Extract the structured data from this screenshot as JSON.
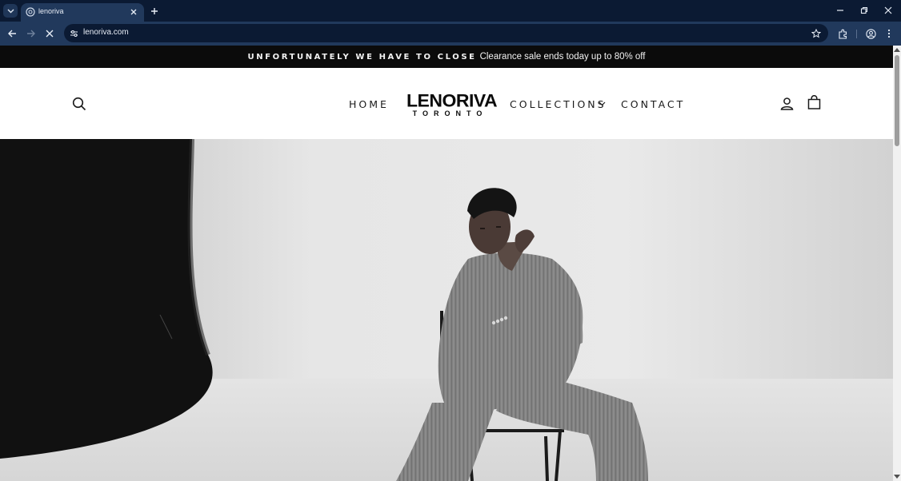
{
  "browser": {
    "tab_title": "lenoriva",
    "url": "lenoriva.com",
    "icons": {
      "tab_search": "chevron-down-icon",
      "favicon": "globe-icon",
      "tab_close": "close-icon",
      "new_tab": "plus-icon",
      "back": "arrow-left-icon",
      "forward": "arrow-right-icon",
      "stop": "close-icon",
      "site_info": "tune-icon",
      "bookmark": "star-icon",
      "extensions": "puzzle-icon",
      "profile": "account-circle-icon",
      "menu": "kebab-icon",
      "minimize": "minimize-icon",
      "restore": "restore-icon",
      "close_window": "close-icon"
    },
    "colors": {
      "frame": "#0b1a33",
      "toolbar": "#21395c"
    }
  },
  "announcement": {
    "strong": "UNFORTUNATELY WE HAVE TO CLOSE",
    "rest": "Clearance sale ends today up to 80% off"
  },
  "header": {
    "logo_main": "LENORIVA",
    "logo_sub": "TORONTO",
    "nav": {
      "home": "HOME",
      "collections": "COLLECTIONS",
      "contact": "CONTACT"
    },
    "icons": {
      "search": "search-icon",
      "collections_caret": "chevron-down-icon",
      "account": "user-icon",
      "cart": "shopping-bag-icon"
    }
  },
  "hero": {
    "image": "black-and-white photo of a model in a pinstripe suit seated on a chair"
  }
}
